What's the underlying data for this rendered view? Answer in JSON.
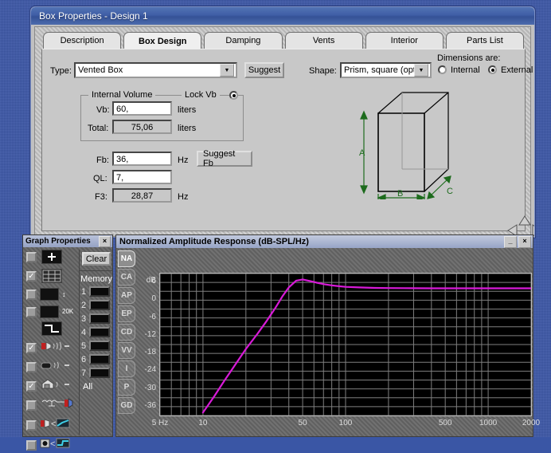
{
  "desktop": {
    "bg": "#3c57a8"
  },
  "box_window": {
    "title": "Box Properties - Design 1",
    "tabs": [
      {
        "label": "Description",
        "active": false
      },
      {
        "label": "Box Design",
        "active": true
      },
      {
        "label": "Damping",
        "active": false
      },
      {
        "label": "Vents",
        "active": false
      },
      {
        "label": "Interior",
        "active": false
      },
      {
        "label": "Parts List",
        "active": false
      }
    ],
    "type_label": "Type:",
    "type_value": "Vented Box",
    "suggest_button": "Suggest",
    "shape_label": "Shape:",
    "shape_value": "Prism, square (opt.)",
    "dimensions_label": "Dimensions are:",
    "dim_internal": "Internal",
    "dim_external": "External",
    "dim_selected": "External",
    "internal_volume": {
      "legend": "Internal Volume",
      "lock_label": "Lock Vb",
      "lock_checked": true,
      "vb_label": "Vb:",
      "vb_value": "60,",
      "vb_units": "liters",
      "total_label": "Total:",
      "total_value": "75,06",
      "total_units": "liters"
    },
    "fb_label": "Fb:",
    "fb_value": "36,",
    "fb_units": "Hz",
    "suggest_fb_button": "Suggest Fb",
    "ql_label": "QL:",
    "ql_value": "7,",
    "f3_label": "F3:",
    "f3_value": "28,87",
    "f3_units": "Hz",
    "diagram": {
      "dim_a": "A",
      "dim_b": "B",
      "dim_c": "C",
      "line_color": "#1d6b1d"
    }
  },
  "graph_properties": {
    "title": "Graph Properties",
    "close_label": "×",
    "clear_button": "Clear",
    "memory_label": "Memory",
    "memory_slots": [
      "1",
      "2",
      "3",
      "4",
      "5",
      "6",
      "7"
    ],
    "memory_all": "All",
    "option_rows": [
      {
        "icon": "crosshair-icon",
        "checked": false
      },
      {
        "icon": "grid-icon",
        "checked": true
      },
      {
        "icon": "vertical-scale-icon",
        "checked": false
      },
      {
        "icon": "horizontal-scale-20k-icon",
        "checked": false,
        "caption": "20K"
      },
      {
        "icon": "step-curve-icon",
        "checked": false
      }
    ],
    "source_rows": [
      {
        "icon": "speaker-radiating-icon",
        "checked": true
      },
      {
        "icon": "vent-radiating-icon",
        "checked": false
      },
      {
        "icon": "box-radiating-icon",
        "checked": true
      },
      {
        "icon": "circuit-filter-icon",
        "checked": false
      },
      {
        "icon": "speaker-curve-icon",
        "checked": false
      },
      {
        "icon": "driver-curve-icon",
        "checked": false
      }
    ]
  },
  "graph_window": {
    "title": "Normalized Amplitude Response (dB-SPL/Hz)",
    "minimize_label": "_",
    "close_label": "×",
    "side_tabs": [
      {
        "label": "NA",
        "selected": true
      },
      {
        "label": "CA",
        "selected": false
      },
      {
        "label": "AP",
        "selected": false
      },
      {
        "label": "EP",
        "selected": false
      },
      {
        "label": "CD",
        "selected": false
      },
      {
        "label": "VV",
        "selected": false
      },
      {
        "label": "I",
        "selected": false
      },
      {
        "label": "P",
        "selected": false
      },
      {
        "label": "GD",
        "selected": false
      }
    ]
  },
  "chart_data": {
    "type": "line",
    "title": "Normalized Amplitude Response (dB-SPL/Hz)",
    "xlabel": "",
    "ylabel": "dB",
    "xscale": "log",
    "xlim": [
      5,
      2000
    ],
    "ylim": [
      -39,
      9
    ],
    "grid": true,
    "curve_color": "#d81ad8",
    "background": "#000000",
    "grid_color": "#7f7f7f",
    "y_unit_label": "dB",
    "yticks": [
      6,
      0,
      -6,
      -12,
      -18,
      -24,
      -30,
      -36
    ],
    "ytick_labels": [
      "6",
      "0",
      "-6",
      "-12",
      "-18",
      "-24",
      "-30",
      "-36"
    ],
    "xticks": [
      5,
      10,
      50,
      100,
      500,
      1000,
      2000
    ],
    "xtick_labels": [
      "5 Hz",
      "10",
      "50",
      "100",
      "500",
      "1000",
      "2000"
    ],
    "series": [
      {
        "name": "Normalized Amplitude Response",
        "x": [
          10,
          12,
          14,
          17,
          20,
          24,
          28,
          32,
          36,
          40,
          45,
          50,
          56,
          63,
          71,
          80,
          90,
          100,
          125,
          160,
          200,
          300,
          400,
          500,
          700,
          1000,
          1500,
          2000
        ],
        "y": [
          -38.0,
          -32.5,
          -27.5,
          -21.5,
          -16.5,
          -11.5,
          -7.0,
          -2.8,
          1.2,
          4.3,
          6.6,
          7.0,
          6.5,
          5.9,
          5.4,
          5.0,
          4.7,
          4.5,
          4.3,
          4.15,
          4.1,
          4.05,
          4.02,
          4.0,
          4.0,
          4.0,
          4.0,
          4.0
        ]
      }
    ]
  }
}
